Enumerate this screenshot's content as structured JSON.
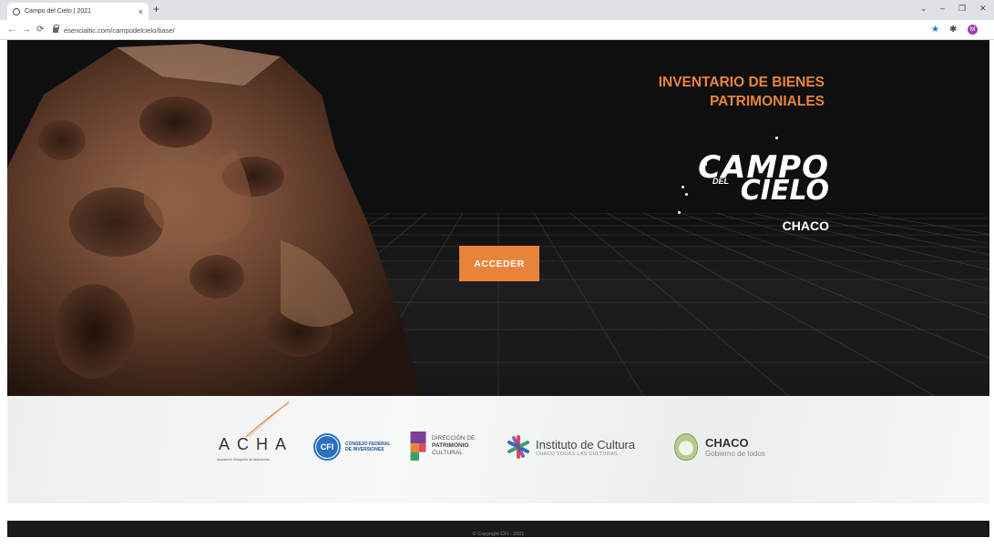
{
  "browser": {
    "tab_title": "Campo del Cielo | 2021",
    "tab_close": "×",
    "new_tab": "+",
    "url": "esencialtic.com/campodelcielo/base/",
    "profile_initial": "M",
    "icons": [
      "back-icon",
      "forward-icon",
      "reload-icon",
      "lock-icon",
      "star-icon",
      "extensions-icon"
    ]
  },
  "hero": {
    "title_line1": "INVENTARIO DE BIENES",
    "title_line2": "PATRIMONIALES",
    "logo": {
      "campo": "CAMPO",
      "del": "DEL",
      "cielo": "CIELO",
      "region": "CHACO"
    },
    "cta_label": "ACCEDER",
    "accent_color": "#e8843a"
  },
  "sponsors": {
    "acha": {
      "name": "ACHA",
      "subtitle": "Asociación Chaqueña de Astronomía"
    },
    "cfi": {
      "mark": "CFI",
      "line1": "CONSEJO FEDERAL",
      "line2": "DE INVERSIONES"
    },
    "patrimonio": {
      "line1": "DIRECCIÓN DE",
      "line2": "PATRIMONIO",
      "line3": "CULTURAL"
    },
    "cultura": {
      "title": "Instituto de Cultura",
      "subtitle": "CHACO TODAS LAS CULTURAS"
    },
    "chaco": {
      "title": "CHACO",
      "subtitle": "Gobierno de todos"
    }
  },
  "footer": {
    "copyright": "© Copyright CFI - 2021"
  }
}
